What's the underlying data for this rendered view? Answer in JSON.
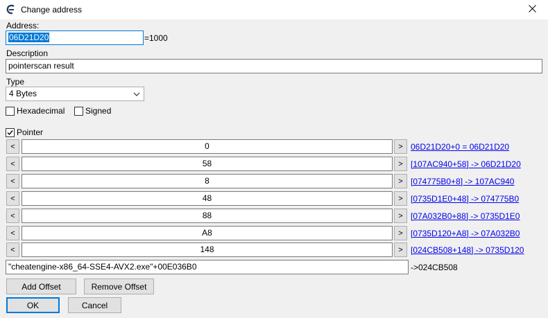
{
  "window": {
    "title": "Change address"
  },
  "address": {
    "label": "Address:",
    "value": "06D21D20",
    "result": "=1000"
  },
  "description": {
    "label": "Description",
    "value": "pointerscan result"
  },
  "type": {
    "label": "Type",
    "selected": "4 Bytes"
  },
  "options": {
    "hexadecimal": "Hexadecimal",
    "signed": "Signed",
    "hexadecimal_checked": false,
    "signed_checked": false
  },
  "pointer": {
    "label": "Pointer",
    "checked": true,
    "offsets": [
      {
        "value": "0",
        "link": "06D21D20+0 = 06D21D20"
      },
      {
        "value": "58",
        "link": "[107AC940+58] -> 06D21D20"
      },
      {
        "value": "8",
        "link": "[074775B0+8] -> 107AC940"
      },
      {
        "value": "48",
        "link": "[0735D1E0+48] -> 074775B0"
      },
      {
        "value": "88",
        "link": "[07A032B0+88] -> 0735D1E0"
      },
      {
        "value": "A8",
        "link": "[0735D120+A8] -> 07A032B0"
      },
      {
        "value": "148",
        "link": "[024CB508+148] -> 0735D120"
      }
    ],
    "decrease_label": "<",
    "increase_label": ">",
    "base_address": "\"cheatengine-x86_64-SSE4-AVX2.exe\"+00E036B0",
    "base_result": "->024CB508"
  },
  "buttons": {
    "add_offset": "Add Offset",
    "remove_offset": "Remove Offset",
    "ok": "OK",
    "cancel": "Cancel"
  },
  "icons": {
    "app": "cheat-engine-icon",
    "close": "close-icon"
  }
}
